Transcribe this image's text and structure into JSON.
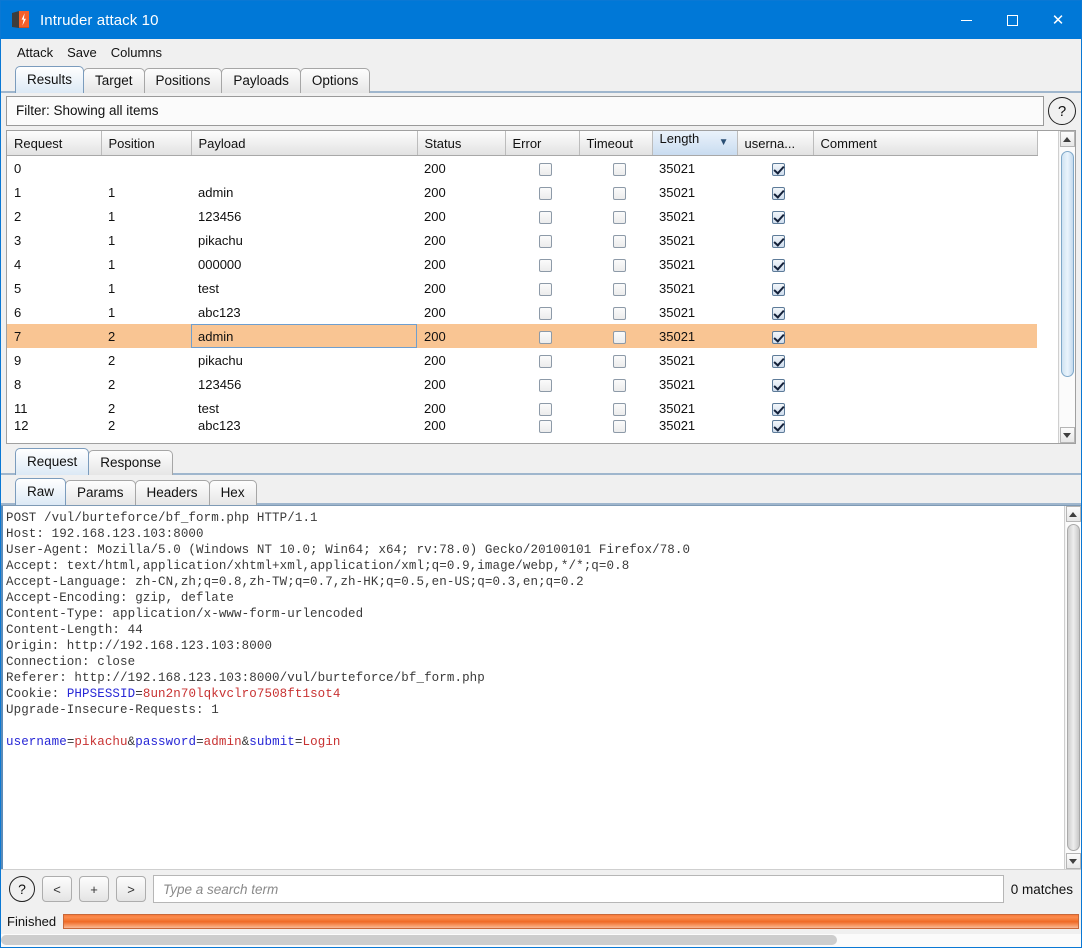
{
  "window": {
    "title": "Intruder attack 10",
    "icon": "burp-suite-icon",
    "minimize": "–",
    "maximize": "□",
    "close": "✕"
  },
  "menubar": {
    "items": [
      "Attack",
      "Save",
      "Columns"
    ]
  },
  "tabs": {
    "items": [
      "Results",
      "Target",
      "Positions",
      "Payloads",
      "Options"
    ],
    "active": "Results"
  },
  "filter": {
    "text": "Filter: Showing all items",
    "help_label": "?"
  },
  "table": {
    "columns": [
      {
        "label": "Request",
        "key": "request"
      },
      {
        "label": "Position",
        "key": "position"
      },
      {
        "label": "Payload",
        "key": "payload"
      },
      {
        "label": "Status",
        "key": "status"
      },
      {
        "label": "Error",
        "key": "error"
      },
      {
        "label": "Timeout",
        "key": "timeout"
      },
      {
        "label": "Length",
        "key": "length",
        "sorted": true,
        "sort_dir": "▼"
      },
      {
        "label": "userna...",
        "key": "username"
      },
      {
        "label": "Comment",
        "key": "comment"
      }
    ],
    "rows": [
      {
        "request": "0",
        "position": "",
        "payload": "",
        "status": "200",
        "error": false,
        "timeout": false,
        "length": "35021",
        "username": true,
        "comment": "",
        "selected": false
      },
      {
        "request": "1",
        "position": "1",
        "payload": "admin",
        "status": "200",
        "error": false,
        "timeout": false,
        "length": "35021",
        "username": true,
        "comment": "",
        "selected": false
      },
      {
        "request": "2",
        "position": "1",
        "payload": "123456",
        "status": "200",
        "error": false,
        "timeout": false,
        "length": "35021",
        "username": true,
        "comment": "",
        "selected": false
      },
      {
        "request": "3",
        "position": "1",
        "payload": "pikachu",
        "status": "200",
        "error": false,
        "timeout": false,
        "length": "35021",
        "username": true,
        "comment": "",
        "selected": false
      },
      {
        "request": "4",
        "position": "1",
        "payload": "000000",
        "status": "200",
        "error": false,
        "timeout": false,
        "length": "35021",
        "username": true,
        "comment": "",
        "selected": false
      },
      {
        "request": "5",
        "position": "1",
        "payload": "test",
        "status": "200",
        "error": false,
        "timeout": false,
        "length": "35021",
        "username": true,
        "comment": "",
        "selected": false
      },
      {
        "request": "6",
        "position": "1",
        "payload": "abc123",
        "status": "200",
        "error": false,
        "timeout": false,
        "length": "35021",
        "username": true,
        "comment": "",
        "selected": false
      },
      {
        "request": "7",
        "position": "2",
        "payload": "admin",
        "status": "200",
        "error": false,
        "timeout": false,
        "length": "35021",
        "username": true,
        "comment": "",
        "selected": true
      },
      {
        "request": "9",
        "position": "2",
        "payload": "pikachu",
        "status": "200",
        "error": false,
        "timeout": false,
        "length": "35021",
        "username": true,
        "comment": "",
        "selected": false
      },
      {
        "request": "8",
        "position": "2",
        "payload": "123456",
        "status": "200",
        "error": false,
        "timeout": false,
        "length": "35021",
        "username": true,
        "comment": "",
        "selected": false
      },
      {
        "request": "11",
        "position": "2",
        "payload": "test",
        "status": "200",
        "error": false,
        "timeout": false,
        "length": "35021",
        "username": true,
        "comment": "",
        "selected": false
      },
      {
        "request": "12",
        "position": "2",
        "payload": "abc123",
        "status": "200",
        "error": false,
        "timeout": false,
        "length": "35021",
        "username": true,
        "comment": "",
        "selected": false
      }
    ]
  },
  "message_tabs": {
    "items": [
      "Request",
      "Response"
    ],
    "active": "Request"
  },
  "sub_tabs": {
    "items": [
      "Raw",
      "Params",
      "Headers",
      "Hex"
    ],
    "active": "Raw"
  },
  "request_raw": {
    "lines": [
      [
        {
          "t": "POST /vul/burteforce/bf_form.php HTTP/1.1",
          "c": "gray"
        }
      ],
      [
        {
          "t": "Host: 192.168.123.103:8000",
          "c": "gray"
        }
      ],
      [
        {
          "t": "User-Agent: Mozilla/5.0 (Windows NT 10.0; Win64; x64; rv:78.0) Gecko/20100101 Firefox/78.0",
          "c": "gray"
        }
      ],
      [
        {
          "t": "Accept: text/html,application/xhtml+xml,application/xml;q=0.9,image/webp,*/*;q=0.8",
          "c": "gray"
        }
      ],
      [
        {
          "t": "Accept-Language: zh-CN,zh;q=0.8,zh-TW;q=0.7,zh-HK;q=0.5,en-US;q=0.3,en;q=0.2",
          "c": "gray"
        }
      ],
      [
        {
          "t": "Accept-Encoding: gzip, deflate",
          "c": "gray"
        }
      ],
      [
        {
          "t": "Content-Type: application/x-www-form-urlencoded",
          "c": "gray"
        }
      ],
      [
        {
          "t": "Content-Length: 44",
          "c": "gray"
        }
      ],
      [
        {
          "t": "Origin: http://192.168.123.103:8000",
          "c": "gray"
        }
      ],
      [
        {
          "t": "Connection: close",
          "c": "gray"
        }
      ],
      [
        {
          "t": "Referer: http://192.168.123.103:8000/vul/burteforce/bf_form.php",
          "c": "gray"
        }
      ],
      [
        {
          "t": "Cookie: ",
          "c": "gray"
        },
        {
          "t": "PHPSESSID",
          "c": "blue"
        },
        {
          "t": "=",
          "c": "gray"
        },
        {
          "t": "8un2n70lqkvclro7508ft1sot4",
          "c": "red"
        }
      ],
      [
        {
          "t": "Upgrade-Insecure-Requests: 1",
          "c": "gray"
        }
      ],
      [
        {
          "t": "",
          "c": "gray"
        }
      ],
      [
        {
          "t": "username",
          "c": "blue"
        },
        {
          "t": "=",
          "c": "gray"
        },
        {
          "t": "pikachu",
          "c": "red"
        },
        {
          "t": "&",
          "c": "gray"
        },
        {
          "t": "password",
          "c": "blue"
        },
        {
          "t": "=",
          "c": "gray"
        },
        {
          "t": "admin",
          "c": "red"
        },
        {
          "t": "&",
          "c": "gray"
        },
        {
          "t": "submit",
          "c": "blue"
        },
        {
          "t": "=",
          "c": "gray"
        },
        {
          "t": "Login",
          "c": "red"
        }
      ]
    ]
  },
  "search": {
    "help_label": "?",
    "prev_label": "<",
    "add_label": "+",
    "next_label": ">",
    "placeholder": "Type a search term",
    "value": "",
    "matches": "0 matches"
  },
  "status": {
    "label": "Finished",
    "progress_percent": 100
  },
  "colors": {
    "titlebar": "#0078d7",
    "selected_row": "#f9c593",
    "progress": "#f4762c",
    "tab_active": "#dce9f5",
    "syntax_key": "#2727d6",
    "syntax_value": "#c83232"
  }
}
